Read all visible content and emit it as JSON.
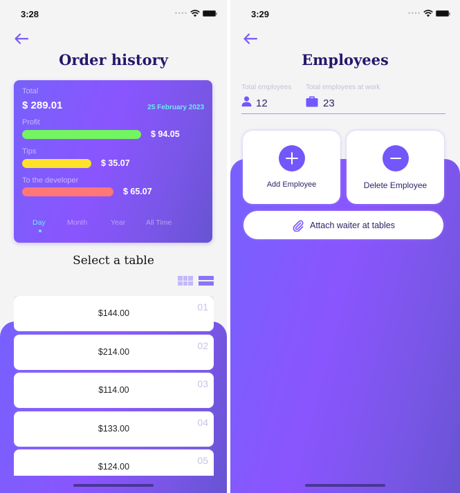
{
  "order_history_screen": {
    "status_bar": {
      "time": "3:28",
      "signal": "••••"
    },
    "back_icon": "arrow-left-icon",
    "title": "Order history",
    "summary": {
      "total_label": "Total",
      "total_value": "$ 289.01",
      "date": "25 February 2023",
      "breakdown": [
        {
          "label": "Profit",
          "value": "$ 94.05",
          "color": "#73f55f",
          "fill_fraction": 1.0
        },
        {
          "label": "Tips",
          "value": "$ 35.07",
          "color": "#fde12a",
          "fill_fraction": 0.58
        },
        {
          "label": "To the developer",
          "value": "$ 65.07",
          "color": "#ff7778",
          "fill_fraction": 0.77
        }
      ],
      "period_tabs": [
        {
          "label": "Day",
          "active": true
        },
        {
          "label": "Month",
          "active": false
        },
        {
          "label": "Year",
          "active": false
        },
        {
          "label": "All Time",
          "active": false
        }
      ]
    },
    "section_title": "Select a table",
    "view_toggle": {
      "grid": "grid-view-icon",
      "list": "list-view-icon",
      "selected": "list"
    },
    "tables": [
      {
        "number": "01",
        "amount": "$144.00"
      },
      {
        "number": "02",
        "amount": "$214.00"
      },
      {
        "number": "03",
        "amount": "$114.00"
      },
      {
        "number": "04",
        "amount": "$133.00"
      },
      {
        "number": "05",
        "amount": "$124.00"
      }
    ]
  },
  "employees_screen": {
    "status_bar": {
      "time": "3:29",
      "signal": "••••"
    },
    "back_icon": "arrow-left-icon",
    "title": "Employees",
    "stats": {
      "total_label": "Total employees",
      "total_value": "12",
      "at_work_label": "Total employees at work",
      "at_work_value": "23"
    },
    "actions": {
      "add_label": "Add Employee",
      "delete_label": "Delete Employee",
      "attach_label": "Attach waiter at tables"
    }
  },
  "colors": {
    "accent": "#7357fb",
    "title": "#24186b",
    "date_cyan": "#6ee8f0",
    "background": "#f4f4f5"
  }
}
